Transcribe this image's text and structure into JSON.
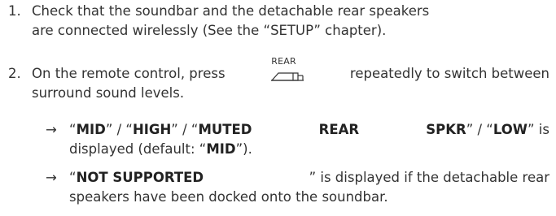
{
  "steps": [
    {
      "number": "1.",
      "lines": [
        "Check that the soundbar and the detachable rear speakers",
        "are connected wirelessly (See the “SETUP” chapter)."
      ]
    },
    {
      "number": "2.",
      "line1_before": "On the remote control, press",
      "line1_after": "repeatedly to switch between",
      "button_label": "REAR",
      "button_icon": "rear-speaker-icon",
      "line2": "surround sound levels.",
      "results": [
        {
          "arrow": "→",
          "line1_parts": [
            {
              "text": "“",
              "bold": false
            },
            {
              "text": "MID",
              "bold": true
            },
            {
              "text": "” / “",
              "bold": false
            },
            {
              "text": "HIGH",
              "bold": true
            },
            {
              "text": "” / “",
              "bold": false
            },
            {
              "text": "MUTED",
              "bold": true
            },
            {
              "text": "REAR",
              "bold": true
            },
            {
              "text": "SPKR",
              "bold": true
            },
            {
              "text": "” / “",
              "bold": false
            },
            {
              "text": "LOW",
              "bold": true
            },
            {
              "text": "” is",
              "bold": false
            }
          ],
          "line2_before": "displayed (default: “",
          "line2_bold": "MID",
          "line2_after": "”)."
        },
        {
          "arrow": "→",
          "line1_open": "“",
          "line1_bold": "NOT SUPPORTED",
          "line1_rest": "” is displayed if the detachable rear",
          "line2": "speakers have been docked onto the soundbar."
        }
      ]
    }
  ]
}
